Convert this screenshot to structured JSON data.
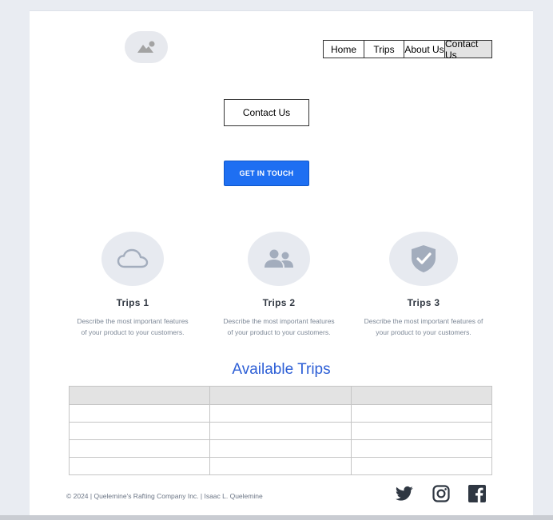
{
  "nav": {
    "items": [
      {
        "label": "Home"
      },
      {
        "label": "Trips"
      },
      {
        "label": "About Us"
      },
      {
        "label": "Contact Us"
      }
    ]
  },
  "hero": {
    "title_box": "Contact Us",
    "cta_label": "GET IN TOUCH"
  },
  "features": [
    {
      "icon": "cloud-icon",
      "title": "Trips 1",
      "description_line1": "Describe the most important features",
      "description_line2": "of your product to your customers."
    },
    {
      "icon": "users-icon",
      "title": "Trips 2",
      "description_line1": "Describe the most important features",
      "description_line2": "of your product to your customers."
    },
    {
      "icon": "shield-check-icon",
      "title": "Trips 3",
      "description_line1": "Describe the most important features of",
      "description_line2": "your product to your customers."
    }
  ],
  "trips_section": {
    "heading": "Available Trips",
    "columns": [
      "",
      "",
      ""
    ],
    "rows": [
      [
        "",
        "",
        ""
      ],
      [
        "",
        "",
        ""
      ],
      [
        "",
        "",
        ""
      ],
      [
        "",
        "",
        ""
      ]
    ]
  },
  "footer": {
    "copyright": "© 2024 | Quelemine's Rafting Company Inc. | Isaac L. Quelemine",
    "social": [
      "twitter-icon",
      "instagram-icon",
      "facebook-icon"
    ]
  },
  "colors": {
    "accent": "#1e6ff2",
    "heading": "#2d5fd6",
    "icon_gray": "#a3adbd",
    "background": "#e9ecf2"
  }
}
